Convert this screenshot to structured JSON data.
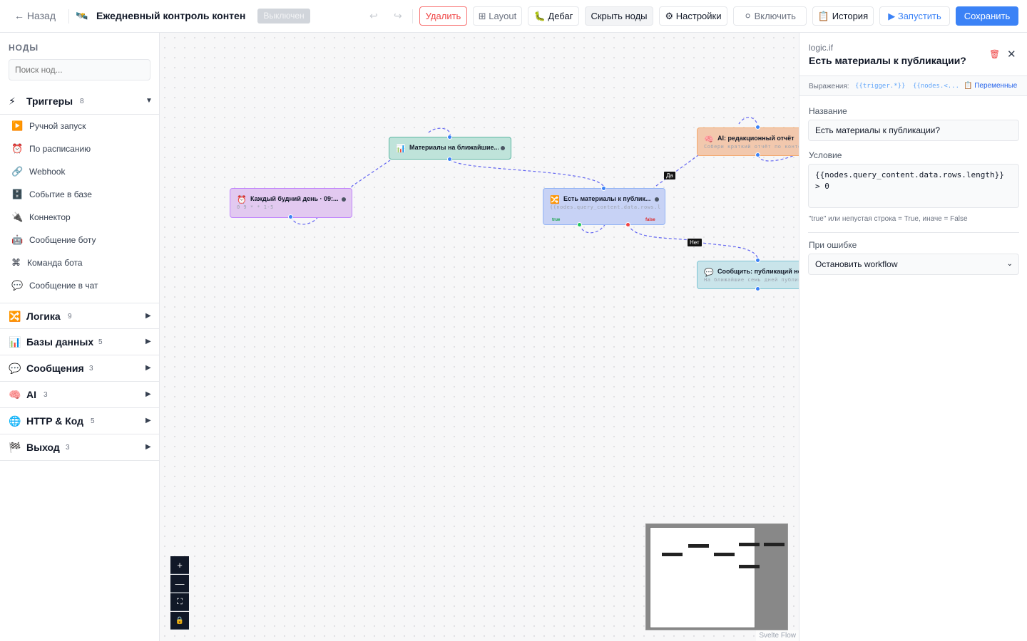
{
  "header": {
    "back_label": "← Назад",
    "workflow_icon": "🛰️",
    "workflow_title": "Ежедневный контроль контен",
    "status": "Выключен",
    "undo": "↩",
    "redo": "↪",
    "buttons": {
      "delete": "Удалить",
      "layout": "⊞ Layout",
      "debug": "🐛 Дебаг",
      "hide_nodes": "Скрыть ноды",
      "settings": "⚙ Настройки",
      "enable": "⚪ Включить",
      "history": "📋 История",
      "run": "▶ Запустить",
      "save": "Сохранить"
    }
  },
  "sidebar": {
    "heading": "НОДЫ",
    "search_placeholder": "Поиск нод...",
    "categories": [
      {
        "icon": "⚡",
        "label": "Триггеры",
        "count": "8",
        "arrow": "▼"
      },
      {
        "icon": "🔀",
        "label": "Логика",
        "count": "9",
        "arrow": "▶"
      },
      {
        "icon": "📊",
        "label": "Базы данных",
        "count": "5",
        "arrow": "▶"
      },
      {
        "icon": "💬",
        "label": "Сообщения",
        "count": "3",
        "arrow": "▶"
      },
      {
        "icon": "🧠",
        "label": "AI",
        "count": "3",
        "arrow": "▶"
      },
      {
        "icon": "🌐",
        "label": "HTTP & Код",
        "count": "5",
        "arrow": "▶"
      },
      {
        "icon": "🏁",
        "label": "Выход",
        "count": "3",
        "arrow": "▶"
      }
    ],
    "trigger_items": [
      {
        "icon": "▶️",
        "label": "Ручной запуск"
      },
      {
        "icon": "⏰",
        "label": "По расписанию"
      },
      {
        "icon": "🔗",
        "label": "Webhook"
      },
      {
        "icon": "🗄️",
        "label": "Событие в базе"
      },
      {
        "icon": "🔌",
        "label": "Коннектор"
      },
      {
        "icon": "🤖",
        "label": "Сообщение боту"
      },
      {
        "icon": "⌘",
        "label": "Команда бота"
      },
      {
        "icon": "💬",
        "label": "Сообщение в чат"
      }
    ]
  },
  "canvas": {
    "nodes": [
      {
        "icon": "⏰",
        "title": "Каждый будний день · 09:...",
        "sub": "0 9 * * 1-5"
      },
      {
        "icon": "📊",
        "title": "Материалы на ближайшие...",
        "sub": ""
      },
      {
        "icon": "🔀",
        "title": "Есть материалы к публик...",
        "sub": "{{nodes.query_content.data.rows.len",
        "port_true": "true",
        "port_false": "false"
      },
      {
        "icon": "🧠",
        "title": "AI: редакционный отчёт",
        "sub": "Собери краткий отчёт по контент"
      },
      {
        "icon": "💬",
        "title": "Сообщить: публикаций не",
        "sub": "На ближайшие семь дней публикац"
      }
    ],
    "edge_labels": {
      "yes": "Да",
      "no": "Нет"
    },
    "zoom": {
      "in": "+",
      "out": "—",
      "fit": "⛶",
      "lock": "🔒"
    },
    "attribution": "Svelte Flow"
  },
  "panel": {
    "type": "logic.if",
    "title": "Есть материалы к публикации?",
    "trash": "🗑",
    "close": "✕",
    "expressions_label": "Выражения:",
    "expr1": "{{trigger.*}}",
    "expr2": "{{nodes.<...",
    "variables_label": "📋 Переменные",
    "name_label": "Название",
    "name_value": "Есть материалы к публикации?",
    "condition_label": "Условие",
    "condition_value": "{{nodes.query_content.data.rows.length}} > 0",
    "condition_hint": "\"true\" или непустая строка = True, иначе = False",
    "on_error_label": "При ошибке",
    "on_error_value": "Остановить workflow",
    "select_chevron": "⌄"
  },
  "colors": {
    "accent": "#3b82f6",
    "danger": "#ef4444",
    "trigger_node": "#e9d5ff",
    "db_node": "#bfe3da",
    "logic_node": "#c7d2fe",
    "ai_node": "#f5d0b5",
    "message_node": "#c9e4ea"
  }
}
